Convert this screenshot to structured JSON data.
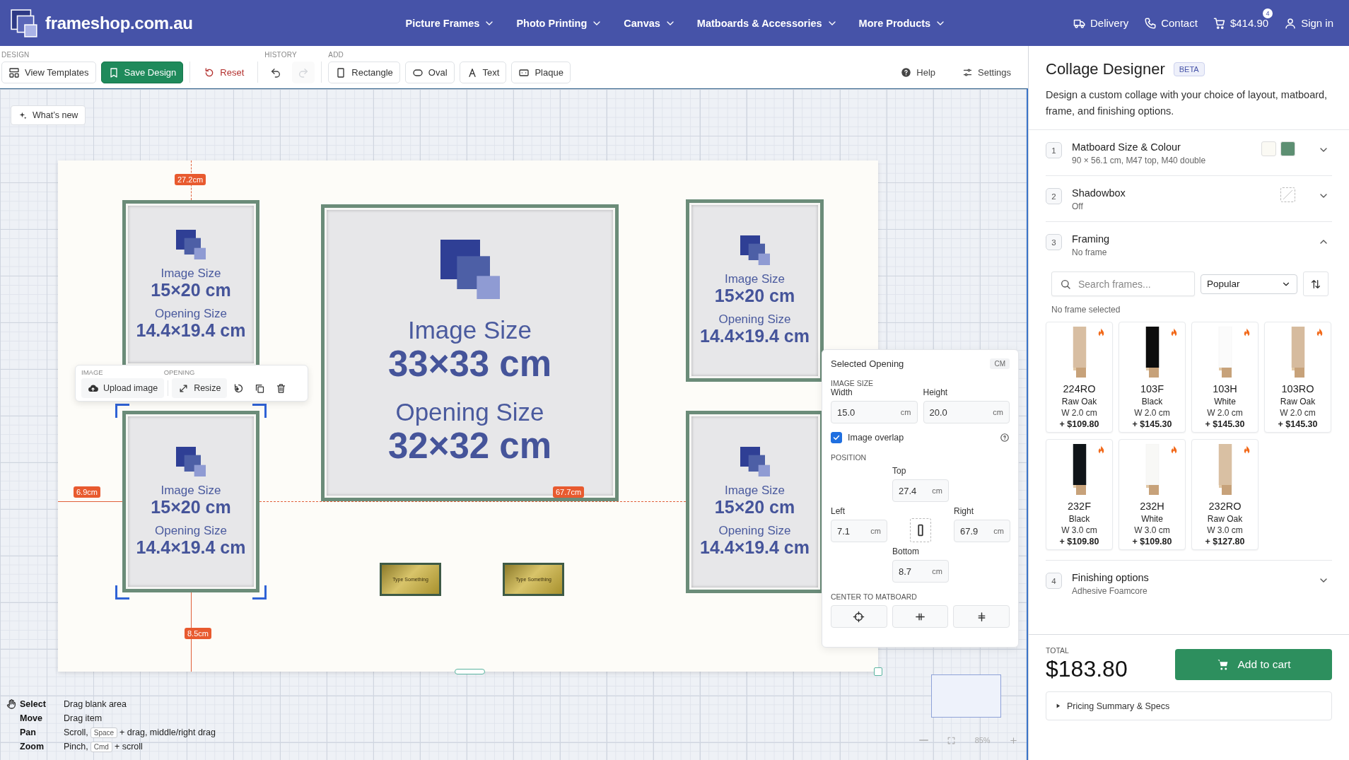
{
  "nav": {
    "logo": "frameshop.com.au",
    "menu": [
      {
        "label": "Picture Frames"
      },
      {
        "label": "Photo Printing"
      },
      {
        "label": "Canvas"
      },
      {
        "label": "Matboards & Accessories"
      },
      {
        "label": "More Products"
      }
    ],
    "actions": [
      {
        "kind": "delivery",
        "label": "Delivery"
      },
      {
        "kind": "contact",
        "label": "Contact"
      },
      {
        "kind": "cart",
        "label": "$414.90",
        "badge": "4"
      },
      {
        "kind": "account",
        "label": "Sign in"
      }
    ]
  },
  "toolbar": {
    "groups": [
      {
        "label": "DESIGN",
        "items": [
          {
            "kind": "templates",
            "label": "View Templates"
          },
          {
            "kind": "save",
            "label": "Save Design"
          }
        ]
      },
      {
        "items": [
          {
            "kind": "reset",
            "label": "Reset"
          }
        ]
      },
      {
        "label": "HISTORY",
        "items": [
          {
            "kind": "undo",
            "disabled": false
          },
          {
            "kind": "redo",
            "disabled": true
          }
        ]
      },
      {
        "label": "ADD",
        "items": [
          {
            "kind": "rectangle",
            "label": "Rectangle"
          },
          {
            "kind": "oval",
            "label": "Oval"
          },
          {
            "kind": "text",
            "label": "Text"
          },
          {
            "kind": "plaque",
            "label": "Plaque"
          }
        ]
      }
    ],
    "right": [
      {
        "kind": "help",
        "label": "Help"
      },
      {
        "kind": "settings",
        "label": "Settings"
      }
    ]
  },
  "canvas": {
    "whats_new": "What’s new",
    "openings": [
      {
        "image_label": "Image Size",
        "image_size": "15×20 cm",
        "opening_label": "Opening Size",
        "opening_size": "14.4×19.4 cm",
        "selected": false
      },
      {
        "image_label": "Image Size",
        "image_size": "33×33 cm",
        "opening_label": "Opening Size",
        "opening_size": "32×32 cm",
        "selected": false
      },
      {
        "image_label": "Image Size",
        "image_size": "15×20 cm",
        "opening_label": "Opening Size",
        "opening_size": "14.4×19.4 cm",
        "selected": false
      },
      {
        "image_label": "Image Size",
        "image_size": "15×20 cm",
        "opening_label": "Opening Size",
        "opening_size": "14.4×19.4 cm",
        "selected": true
      },
      {
        "image_label": "Image Size",
        "image_size": "15×20 cm",
        "opening_label": "Opening Size",
        "opening_size": "14.4×19.4 cm",
        "selected": false
      }
    ],
    "plaques": [
      {
        "text": "Type Something"
      },
      {
        "text": "Type Something"
      }
    ],
    "measurements": [
      "27.2cm",
      "6.9cm",
      "67.7cm",
      "8.5cm"
    ],
    "opening_toolbar": {
      "sections": [
        "IMAGE",
        "OPENING"
      ],
      "buttons": [
        {
          "kind": "upload",
          "label": "Upload image"
        },
        {
          "kind": "resize",
          "label": "Resize"
        },
        {
          "kind": "rotate"
        },
        {
          "kind": "duplicate"
        },
        {
          "kind": "delete"
        }
      ]
    },
    "shortcuts": [
      {
        "action": "Select",
        "parts": [
          {
            "kind": "text",
            "text": "Drag blank area"
          }
        ]
      },
      {
        "action": "Move",
        "parts": [
          {
            "kind": "text",
            "text": "Drag item"
          }
        ]
      },
      {
        "action": "Pan",
        "parts": [
          {
            "kind": "text",
            "text": "Scroll,"
          },
          {
            "kind": "key",
            "text": "Space"
          },
          {
            "kind": "text",
            "text": "+ drag, middle/right drag"
          }
        ]
      },
      {
        "action": "Zoom",
        "parts": [
          {
            "kind": "text",
            "text": "Pinch,"
          },
          {
            "kind": "key",
            "text": "Cmd"
          },
          {
            "kind": "text",
            "text": "+ scroll"
          }
        ]
      }
    ],
    "zoom": "85%"
  },
  "opening_panel": {
    "title": "Selected Opening",
    "unit": "CM",
    "image_size_label": "IMAGE SIZE",
    "size_fields": [
      {
        "label": "Width",
        "value": "15.0",
        "unit": "cm"
      },
      {
        "label": "Height",
        "value": "20.0",
        "unit": "cm"
      }
    ],
    "overlap": {
      "label": "Image overlap",
      "checked": true
    },
    "position_label": "POSITION",
    "position": {
      "top": {
        "label": "Top",
        "value": "27.4",
        "unit": "cm"
      },
      "left": {
        "label": "Left",
        "value": "7.1",
        "unit": "cm"
      },
      "right": {
        "label": "Right",
        "value": "67.9",
        "unit": "cm"
      },
      "bottom": {
        "label": "Bottom",
        "value": "8.7",
        "unit": "cm"
      }
    },
    "center_label": "CENTER TO MATBOARD",
    "center_buttons": [
      {
        "kind": "both"
      },
      {
        "kind": "horizontal"
      },
      {
        "kind": "vertical"
      }
    ]
  },
  "sidebar": {
    "title": "Collage Designer",
    "badge": "BETA",
    "description": "Design a custom collage with your choice of layout, matboard, frame, and finishing options.",
    "steps": [
      {
        "number": "1",
        "title": "Matboard Size & Colour",
        "summary": "90 × 56.1 cm, M47 top, M40 double",
        "expanded": false,
        "swatches": [
          {
            "kind": "color",
            "color": "#fbfaf4"
          },
          {
            "kind": "color",
            "color": "#5d8f72"
          }
        ]
      },
      {
        "number": "2",
        "title": "Shadowbox",
        "summary": "Off",
        "expanded": false,
        "swatches": [
          {
            "kind": "none"
          }
        ]
      },
      {
        "number": "3",
        "title": "Framing",
        "summary": "No frame",
        "expanded": true,
        "frame_picker": {
          "search_placeholder": "Search frames...",
          "sort": "Popular",
          "status": "No frame selected",
          "frames": [
            {
              "code": "224RO",
              "name": "Raw Oak",
              "width": "W 2.0 cm",
              "price": "+ $109.80",
              "popular": true,
              "color": "#d8bea2"
            },
            {
              "code": "103F",
              "name": "Black",
              "width": "W 2.0 cm",
              "price": "+ $145.30",
              "popular": true,
              "color": "#0d0d0d"
            },
            {
              "code": "103H",
              "name": "White",
              "width": "W 2.0 cm",
              "price": "+ $145.30",
              "popular": true,
              "color": "#fbfbfb"
            },
            {
              "code": "103RO",
              "name": "Raw Oak",
              "width": "W 2.0 cm",
              "price": "+ $145.30",
              "popular": true,
              "color": "#d6bb9e"
            },
            {
              "code": "232F",
              "name": "Black",
              "width": "W 3.0 cm",
              "price": "+ $109.80",
              "popular": true,
              "color": "#0f1418"
            },
            {
              "code": "232H",
              "name": "White",
              "width": "W 3.0 cm",
              "price": "+ $109.80",
              "popular": true,
              "color": "#f8f8f6"
            },
            {
              "code": "232RO",
              "name": "Raw Oak",
              "width": "W 3.0 cm",
              "price": "+ $127.80",
              "popular": true,
              "color": "#d9c0a3"
            }
          ]
        }
      },
      {
        "number": "4",
        "title": "Finishing options",
        "summary": "Adhesive Foamcore",
        "expanded": false
      }
    ],
    "total_label": "TOTAL",
    "total": "$183.80",
    "add_to_cart": "Add to cart",
    "pricing_summary": "Pricing Summary & Specs",
    "pricing_expanded": false
  }
}
